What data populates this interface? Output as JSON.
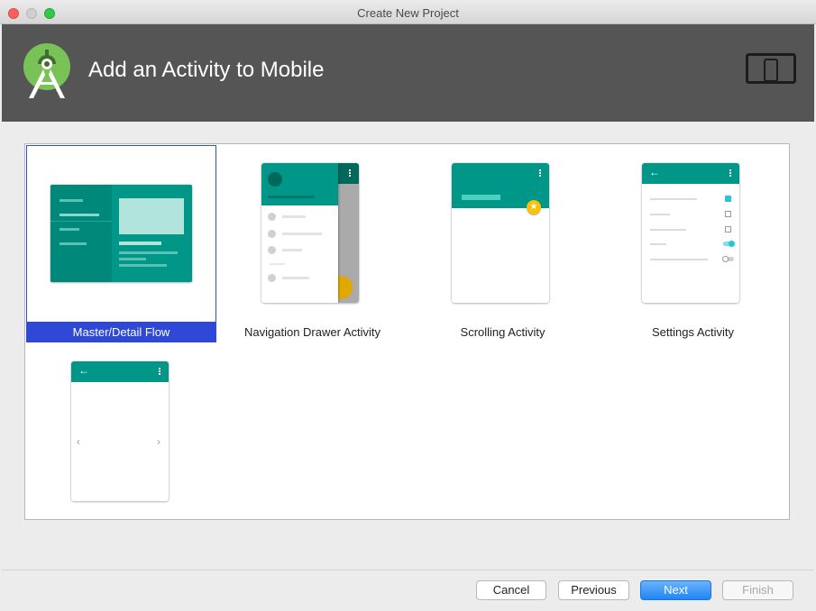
{
  "window": {
    "title": "Create New Project"
  },
  "header": {
    "title": "Add an Activity to Mobile",
    "logo": "android-studio-icon",
    "device_icon": "phone-tablet-icon"
  },
  "gallery": {
    "items": [
      {
        "label": "Master/Detail Flow",
        "selected": true
      },
      {
        "label": "Navigation Drawer Activity",
        "selected": false
      },
      {
        "label": "Scrolling Activity",
        "selected": false
      },
      {
        "label": "Settings Activity",
        "selected": false
      },
      {
        "label": "",
        "selected": false
      }
    ]
  },
  "footer": {
    "cancel": "Cancel",
    "previous": "Previous",
    "next": "Next",
    "finish": "Finish"
  },
  "colors": {
    "teal": "#009688",
    "dark_teal": "#00796b",
    "selection": "#2f48d6",
    "header_bg": "#555555",
    "accent_yellow": "#ffc107"
  }
}
